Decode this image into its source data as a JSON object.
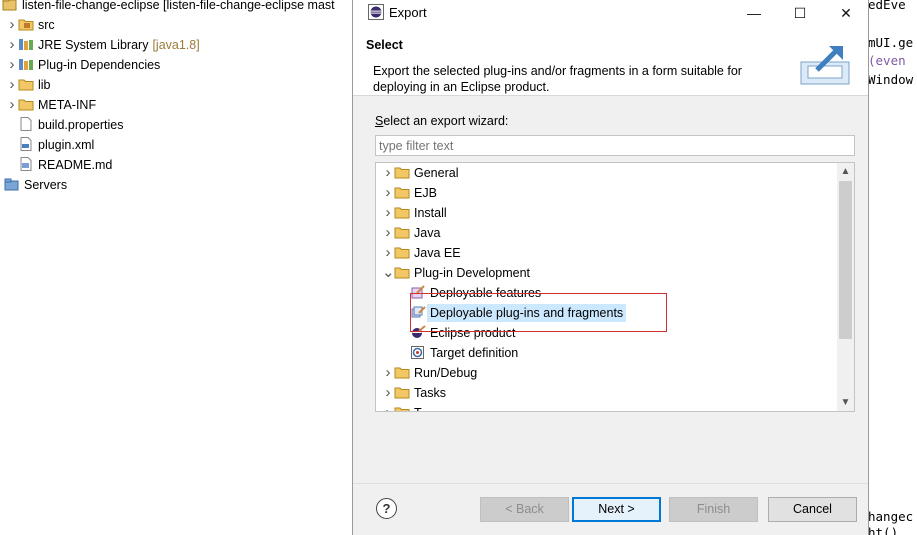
{
  "explorer": {
    "project": "listen-file-change-eclipse [listen-file-change-eclipse mast",
    "items": [
      {
        "label": "src",
        "icon": "package-folder-icon",
        "chevron": true
      },
      {
        "label": "JRE System Library",
        "suffix": "[java1.8]",
        "icon": "library-icon",
        "chevron": true
      },
      {
        "label": "Plug-in Dependencies",
        "icon": "library-icon",
        "chevron": true
      },
      {
        "label": "lib",
        "icon": "folder-icon",
        "chevron": true
      },
      {
        "label": "META-INF",
        "icon": "folder-icon",
        "chevron": true
      },
      {
        "label": "build.properties",
        "icon": "file-icon",
        "chevron": false
      },
      {
        "label": "plugin.xml",
        "icon": "xml-file-icon",
        "chevron": false
      },
      {
        "label": "README.md",
        "icon": "md-file-icon",
        "chevron": false
      }
    ],
    "servers": "Servers"
  },
  "editor": {
    "lines": [
      "edEve",
      "mUI.ge",
      "(even",
      "Window",
      "hangec",
      "ht()"
    ]
  },
  "dialog": {
    "title": "Export",
    "minimize": "—",
    "maximize": "☐",
    "close": "✕",
    "header_title": "Select",
    "header_desc": "Export the selected plug-ins and/or fragments in a form suitable for deploying in an Eclipse product.",
    "wizard_label": "Select an export wizard:",
    "filter_placeholder": "type filter text",
    "tree": [
      {
        "label": "General",
        "level": 0,
        "expanded": false,
        "icon": "folder-icon"
      },
      {
        "label": "EJB",
        "level": 0,
        "expanded": false,
        "icon": "folder-icon"
      },
      {
        "label": "Install",
        "level": 0,
        "expanded": false,
        "icon": "folder-icon"
      },
      {
        "label": "Java",
        "level": 0,
        "expanded": false,
        "icon": "folder-icon"
      },
      {
        "label": "Java EE",
        "level": 0,
        "expanded": false,
        "icon": "folder-icon"
      },
      {
        "label": "Plug-in Development",
        "level": 0,
        "expanded": true,
        "icon": "folder-icon"
      },
      {
        "label": "Deployable features",
        "level": 1,
        "icon": "feature-export-icon"
      },
      {
        "label": "Deployable plug-ins and fragments",
        "level": 1,
        "icon": "plugin-export-icon",
        "selected": true
      },
      {
        "label": "Eclipse product",
        "level": 1,
        "icon": "product-export-icon"
      },
      {
        "label": "Target definition",
        "level": 1,
        "icon": "target-definition-icon"
      },
      {
        "label": "Run/Debug",
        "level": 0,
        "expanded": false,
        "icon": "folder-icon"
      },
      {
        "label": "Tasks",
        "level": 0,
        "expanded": false,
        "icon": "folder-icon"
      },
      {
        "label": "T...",
        "level": 0,
        "expanded": false,
        "icon": "folder-icon"
      }
    ],
    "buttons": {
      "help": "?",
      "back": "< Back",
      "next": "Next >",
      "finish": "Finish",
      "cancel": "Cancel"
    },
    "colors": {
      "selection": "#cce8ff",
      "highlight_box": "#d03030",
      "default_button": "#0078d7"
    }
  }
}
